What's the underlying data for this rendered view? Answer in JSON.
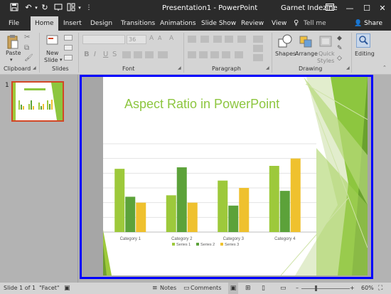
{
  "title_bar": {
    "document_title": "Presentation1 - PowerPoint",
    "user_name": "Garnet Indezine",
    "quick_access": [
      "save-icon",
      "undo-icon",
      "redo-icon",
      "from-beginning-icon",
      "customize-icon"
    ]
  },
  "tabs": [
    {
      "label": "File"
    },
    {
      "label": "Home"
    },
    {
      "label": "Insert"
    },
    {
      "label": "Design"
    },
    {
      "label": "Transitions"
    },
    {
      "label": "Animations"
    },
    {
      "label": "Slide Show"
    },
    {
      "label": "Review"
    },
    {
      "label": "View"
    }
  ],
  "tell_me": "Tell me",
  "share": "Share",
  "ribbon": {
    "groups": [
      "Clipboard",
      "Slides",
      "Font",
      "Paragraph",
      "Drawing"
    ],
    "paste": "Paste",
    "new_slide": "New",
    "new_slide_2": "Slide",
    "font_size": "36",
    "shapes": "Shapes",
    "arrange": "Arrange",
    "quick_styles_1": "Quick",
    "quick_styles_2": "Styles",
    "editing": "Editing",
    "bold": "B",
    "italic": "I",
    "underline": "U",
    "shadow": "S"
  },
  "thumbnail": {
    "number": "1"
  },
  "slide": {
    "title": "Aspect Ratio in PowerPoint",
    "accent": "#8dc63f"
  },
  "chart_data": {
    "type": "bar",
    "categories": [
      "Category 1",
      "Category 2",
      "Category 3",
      "Category 4"
    ],
    "series": [
      {
        "name": "Series 1",
        "color": "#9dc93b",
        "values": [
          4.3,
          2.5,
          3.5,
          4.5
        ]
      },
      {
        "name": "Series 2",
        "color": "#5ca23a",
        "values": [
          2.4,
          4.4,
          1.8,
          2.8
        ]
      },
      {
        "name": "Series 3",
        "color": "#efc12e",
        "values": [
          2.0,
          2.0,
          3.0,
          5.0
        ]
      }
    ],
    "ylim": [
      0,
      6
    ],
    "grid": true,
    "legend": "bottom"
  },
  "status": {
    "slide_info": "Slide 1 of 1",
    "theme": "\"Facet\"",
    "notes": "Notes",
    "comments": "Comments",
    "zoom": "60%"
  }
}
